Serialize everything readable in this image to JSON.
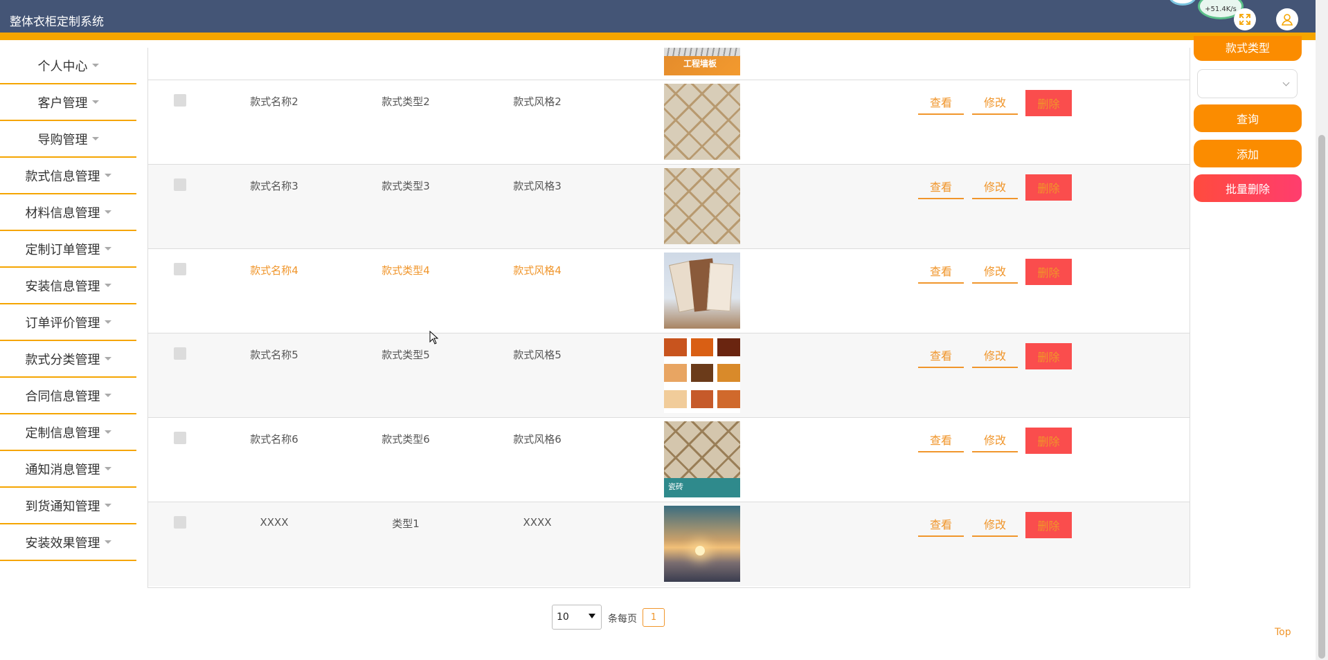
{
  "app": {
    "title": "整体衣柜定制系统",
    "net_speed": "+51.4K/s"
  },
  "sidebar": {
    "items": [
      {
        "label": "个人中心"
      },
      {
        "label": "客户管理"
      },
      {
        "label": "导购管理"
      },
      {
        "label": "款式信息管理"
      },
      {
        "label": "材料信息管理"
      },
      {
        "label": "定制订单管理"
      },
      {
        "label": "安装信息管理"
      },
      {
        "label": "订单评价管理"
      },
      {
        "label": "款式分类管理"
      },
      {
        "label": "合同信息管理"
      },
      {
        "label": "定制信息管理"
      },
      {
        "label": "通知消息管理"
      },
      {
        "label": "到货通知管理"
      },
      {
        "label": "安装效果管理"
      }
    ]
  },
  "rows": [
    {
      "name": "款式名称2",
      "type": "款式类型2",
      "style": "款式风格2",
      "image": "diamond-tile"
    },
    {
      "name": "款式名称3",
      "type": "款式类型3",
      "style": "款式风格3",
      "image": "diamond-tile"
    },
    {
      "name": "款式名称4",
      "type": "款式类型4",
      "style": "款式风格4",
      "image": "wood-panels"
    },
    {
      "name": "款式名称5",
      "type": "款式类型5",
      "style": "款式风格5",
      "image": "wood-swatches"
    },
    {
      "name": "款式名称6",
      "type": "款式类型6",
      "style": "款式风格6",
      "image": "diamond-tile-promo"
    },
    {
      "name": "XXXX",
      "type": "类型1",
      "style": "XXXX",
      "image": "sunset-photo"
    }
  ],
  "top_image": {
    "caption": "工程墙板"
  },
  "promo_text": "瓷砖",
  "actions": {
    "view": "查看",
    "edit": "修改",
    "delete": "删除"
  },
  "right_panel": {
    "partial_label": "款式类型",
    "select_value": "",
    "search": "查询",
    "add": "添加",
    "batch_delete": "批量删除"
  },
  "pagination": {
    "page_size": "10",
    "per_page_label": "条每页",
    "current_page": "1"
  },
  "top_link": "Top",
  "colors": {
    "header": "#445576",
    "accent": "#f5a500",
    "orange": "#fb8c00",
    "red": "#fa4d4d"
  }
}
